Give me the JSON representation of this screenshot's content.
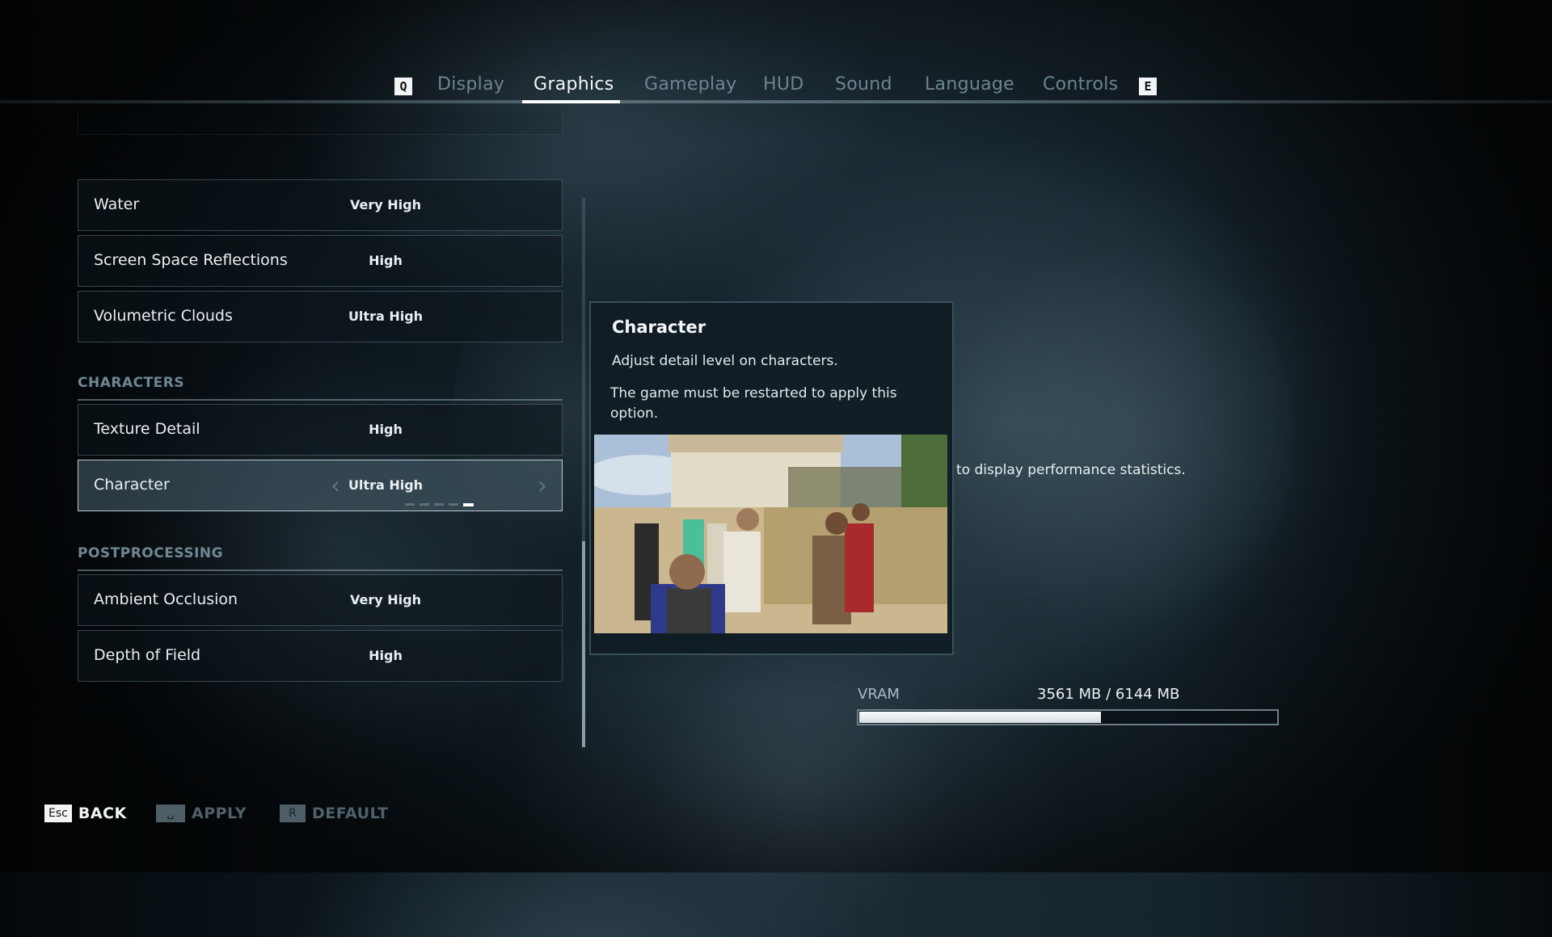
{
  "header": {
    "prev_key": "Q",
    "next_key": "E",
    "tabs": [
      {
        "label": "Display",
        "active": false
      },
      {
        "label": "Graphics",
        "active": true
      },
      {
        "label": "Gameplay",
        "active": false
      },
      {
        "label": "HUD",
        "active": false
      },
      {
        "label": "Sound",
        "active": false
      },
      {
        "label": "Language",
        "active": false
      },
      {
        "label": "Controls",
        "active": false
      }
    ]
  },
  "settings": {
    "environment_rows": [
      {
        "label": "Water",
        "value": "Very High"
      },
      {
        "label": "Screen Space Reflections",
        "value": "High"
      },
      {
        "label": "Volumetric Clouds",
        "value": "Ultra High"
      }
    ],
    "sections": {
      "characters": "CHARACTERS",
      "postprocessing": "POSTPROCESSING"
    },
    "character_rows": [
      {
        "label": "Texture Detail",
        "value": "High"
      },
      {
        "label": "Character",
        "value": "Ultra High",
        "selected": true,
        "level_index": 5,
        "level_count": 5
      }
    ],
    "postprocessing_rows": [
      {
        "label": "Ambient Occlusion",
        "value": "Very High"
      },
      {
        "label": "Depth of Field",
        "value": "High"
      }
    ],
    "arrows": {
      "left": "‹",
      "right": "›"
    }
  },
  "tooltip": {
    "title": "Character",
    "description": "Adjust detail level on characters.",
    "note": "The game must be restarted to apply this option.",
    "image_alt": "Preview of characters in an ancient Greek town"
  },
  "background_text": "to display performance statistics.",
  "vram": {
    "label": "VRAM",
    "used_mb": 3561,
    "total_mb": 6144,
    "text": "3561 MB / 6144 MB",
    "fraction": 0.5796
  },
  "footer": {
    "back": {
      "key": "Esc",
      "label": "BACK"
    },
    "apply": {
      "key": "␣",
      "label": "APPLY"
    },
    "default": {
      "key": "R",
      "label": "DEFAULT"
    }
  },
  "colors": {
    "active_tab": "#f3f6f7",
    "inactive_tab": "#6d8592",
    "section_header": "#6f8793",
    "disabled_action": "#4f616a"
  }
}
